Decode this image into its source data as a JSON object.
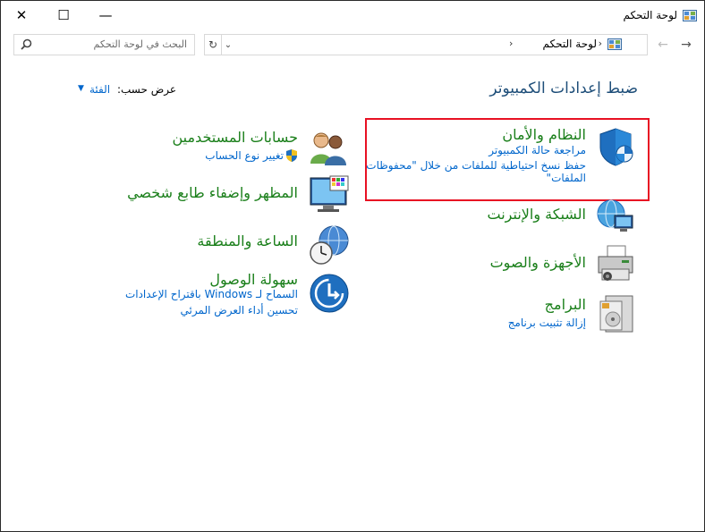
{
  "window": {
    "title": "لوحة التحكم",
    "minimize_symbol": "—",
    "maximize_symbol": "☐",
    "close_symbol": "✕"
  },
  "nav": {
    "back_symbol": "←",
    "forward_symbol": "→",
    "recent_symbol": "⌄",
    "up_symbol": "↑"
  },
  "address": {
    "crumb": "لوحة التحكم",
    "separator": "›",
    "refresh_symbol": "↻",
    "dropdown_symbol": "⌄"
  },
  "search": {
    "placeholder": "البحث في لوحة التحكم"
  },
  "header": {
    "title": "ضبط إعدادات الكمبيوتر",
    "view_by_label": "عرض حسب:",
    "view_by_value": "الفئة",
    "view_by_arrow": "▼"
  },
  "categories": {
    "system": {
      "title": "النظام والأمان",
      "links": [
        "مراجعة حالة الكمبيوتر",
        "حفظ نسخ احتياطية للملفات من خلال \"محفوظات",
        "الملفات\""
      ]
    },
    "network": {
      "title": "الشبكة والإنترنت"
    },
    "hardware": {
      "title": "الأجهزة والصوت"
    },
    "programs": {
      "title": "البرامج",
      "links": [
        "إزالة تثبيت برنامج"
      ]
    },
    "accounts": {
      "title": "حسابات المستخدمين",
      "links": [
        "تغيير نوع الحساب"
      ]
    },
    "appearance": {
      "title": "المظهر وإضفاء طابع شخصي"
    },
    "clock": {
      "title": "الساعة والمنطقة"
    },
    "ease": {
      "title": "سهولة الوصول",
      "links": [
        "السماح لـ Windows باقتراح الإعدادات",
        "تحسين أداء العرض المرئي"
      ]
    }
  },
  "colors": {
    "title_green": "#1a7f1a",
    "link_blue": "#0066cc",
    "highlight_red": "#e81123",
    "heading_blue": "#1e4e79"
  }
}
